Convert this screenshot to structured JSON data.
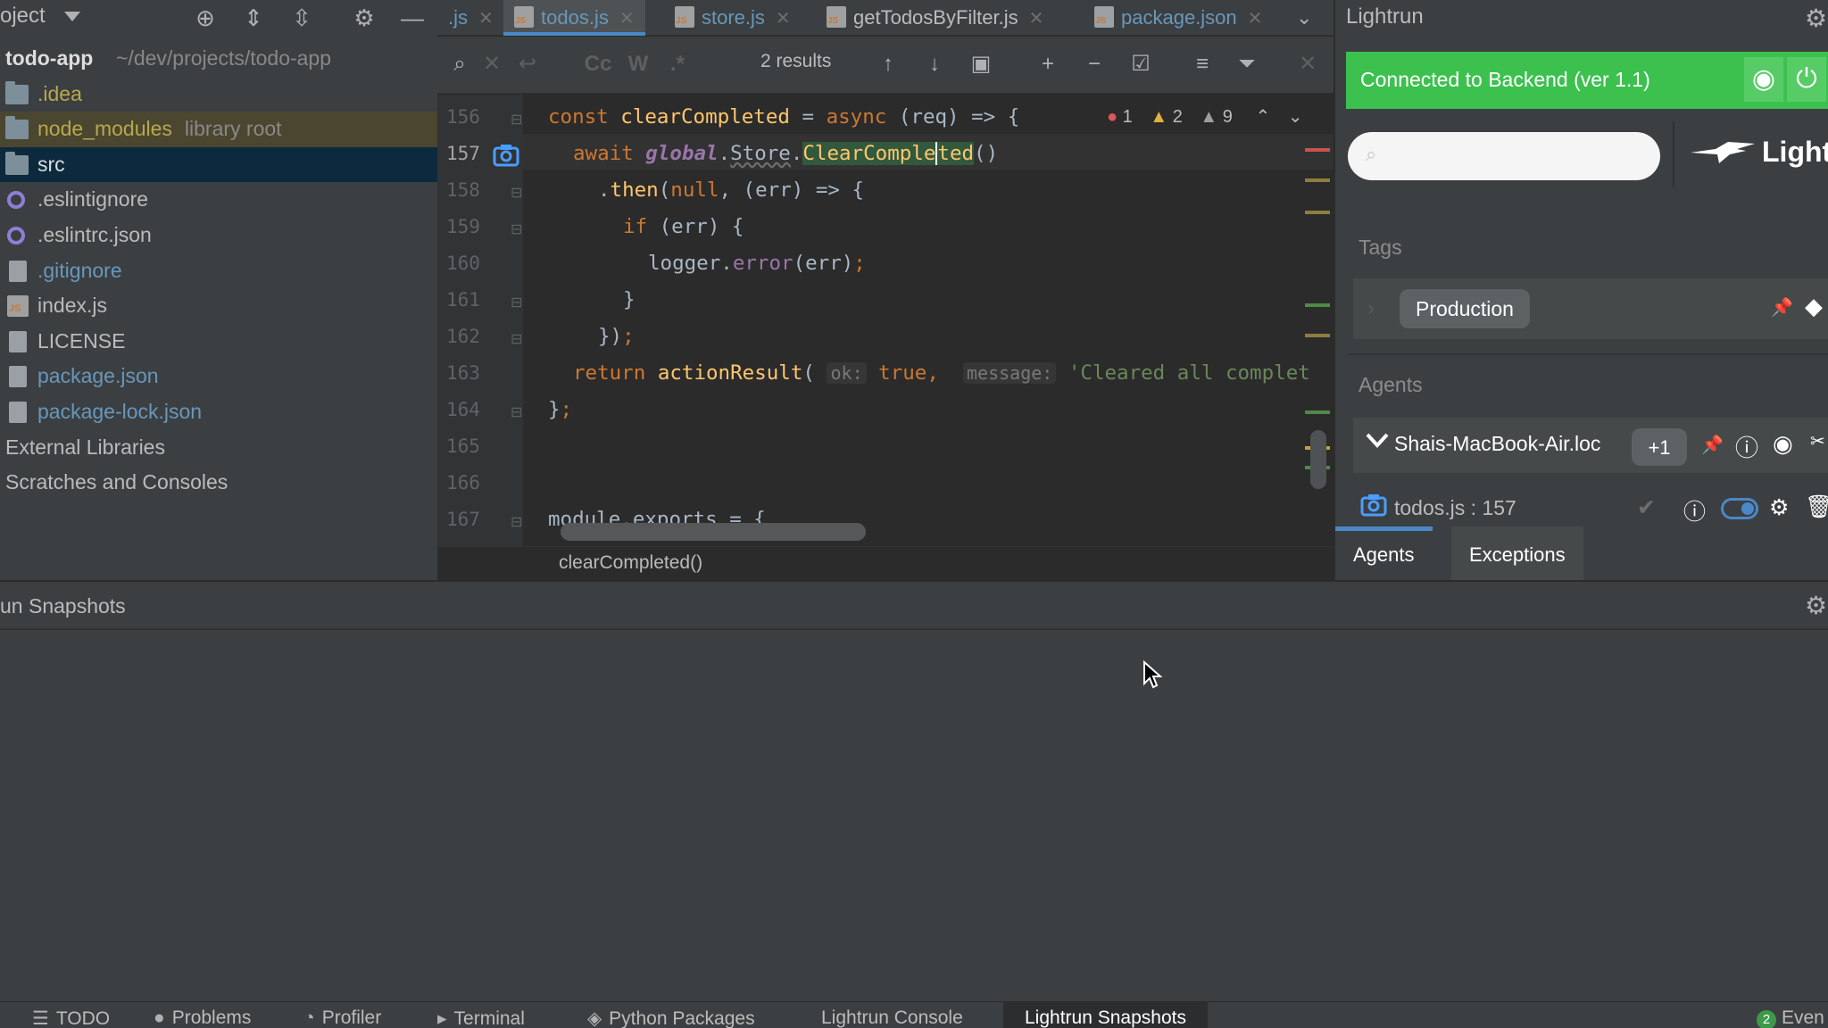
{
  "project": {
    "title": "oject",
    "root_name": "todo-app",
    "root_path": "~/dev/projects/todo-app",
    "items": [
      {
        "label": ".idea",
        "color": "#b8a84d",
        "sub": ""
      },
      {
        "label": "node_modules",
        "color": "#b8a84d",
        "sub": "library root"
      },
      {
        "label": "src",
        "color": "#bbbbbb",
        "sub": ""
      },
      {
        "label": ".eslintignore",
        "color": "#bbbbbb",
        "sub": ""
      },
      {
        "label": ".eslintrc.json",
        "color": "#bbbbbb",
        "sub": ""
      },
      {
        "label": ".gitignore",
        "color": "#6897bb",
        "sub": ""
      },
      {
        "label": "index.js",
        "color": "#bbbbbb",
        "sub": ""
      },
      {
        "label": "LICENSE",
        "color": "#bbbbbb",
        "sub": ""
      },
      {
        "label": "package.json",
        "color": "#6897bb",
        "sub": ""
      },
      {
        "label": "package-lock.json",
        "color": "#6897bb",
        "sub": ""
      },
      {
        "label": "External Libraries",
        "color": "#bbbbbb",
        "sub": ""
      },
      {
        "label": "Scratches and Consoles",
        "color": "#bbbbbb",
        "sub": ""
      }
    ]
  },
  "tabs": [
    {
      "label": ".js"
    },
    {
      "label": "todos.js"
    },
    {
      "label": "store.js"
    },
    {
      "label": "getTodosByFilter.js"
    },
    {
      "label": "package.json"
    }
  ],
  "find": {
    "results": "2 results",
    "cc": "Cc",
    "w": "W",
    "regex": ".*"
  },
  "editor": {
    "line_numbers": [
      "156",
      "157",
      "158",
      "159",
      "160",
      "161",
      "162",
      "163",
      "164",
      "165",
      "166",
      "167"
    ],
    "inspections": {
      "errors": "1",
      "warnings": "2",
      "weak_warnings": "9"
    },
    "line156": {
      "a": "const ",
      "b": "clearCompleted",
      "c": " = ",
      "d": "async",
      "e": " (req) => {"
    },
    "line157": {
      "a": "await ",
      "b": "global",
      "c": ".",
      "d": "Store",
      "e": ".",
      "f": "ClearComple",
      "g": "ted",
      "h": "()"
    },
    "line158": {
      "a": ".",
      "b": "then",
      "c": "(",
      "d": "null",
      "e": ", (err) => {"
    },
    "line159": {
      "a": "if",
      "b": " (err) {"
    },
    "line160": {
      "a": "logger.",
      "b": "error",
      "c": "(err)",
      "d": ";"
    },
    "line161": "}",
    "line162": {
      "a": "})",
      "b": ";"
    },
    "line163": {
      "a": "return ",
      "b": "actionResult",
      "c": "(",
      "h1": "ok:",
      "d": " true",
      "e": ",",
      "h2": "message:",
      "f": " 'Cleared all complet"
    },
    "line164": {
      "a": "}",
      "b": ";"
    },
    "line167": "module.exports = {",
    "breadcrumb": "clearCompleted()"
  },
  "lightrun": {
    "title": "Lightrun",
    "connected": "Connected to Backend (ver 1.1)",
    "search_placeholder": "",
    "logo_text": "Lightr",
    "tags_label": "Tags",
    "tag": "Production",
    "agents_label": "Agents",
    "agent_name": "Shais-MacBook-Air.loc",
    "agent_badge": "+1",
    "snapshot_label": "todos.js : 157",
    "tab_agents": "Agents",
    "tab_exceptions": "Exceptions"
  },
  "snapshots_window": {
    "title": "un Snapshots"
  },
  "toolstrip": [
    {
      "label": "TODO"
    },
    {
      "label": "Problems"
    },
    {
      "label": "Profiler"
    },
    {
      "label": "Terminal"
    },
    {
      "label": "Python Packages"
    },
    {
      "label": "Lightrun Console"
    },
    {
      "label": "Lightrun Snapshots"
    },
    {
      "label": "Even",
      "badge": "2"
    }
  ],
  "colors": {
    "accent": "#4a88c7",
    "connected": "#3cc14f",
    "editor_bg": "#2b2b2b",
    "panel_bg": "#3c3f41"
  }
}
